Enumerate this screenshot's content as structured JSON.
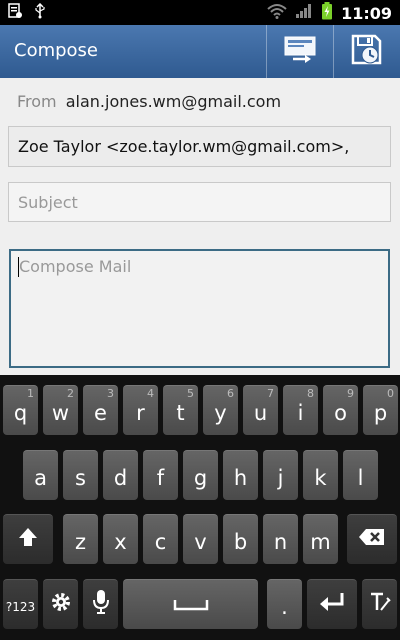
{
  "status": {
    "time": "11:09"
  },
  "actionbar": {
    "title": "Compose"
  },
  "compose": {
    "from_label": "From",
    "from_value": "alan.jones.wm@gmail.com",
    "to_value": "Zoe Taylor <zoe.taylor.wm@gmail.com>,",
    "subject_placeholder": "Subject",
    "body_placeholder": "Compose Mail"
  },
  "keyboard": {
    "row1": [
      {
        "k": "q",
        "n": "1"
      },
      {
        "k": "w",
        "n": "2"
      },
      {
        "k": "e",
        "n": "3"
      },
      {
        "k": "r",
        "n": "4"
      },
      {
        "k": "t",
        "n": "5"
      },
      {
        "k": "y",
        "n": "6"
      },
      {
        "k": "u",
        "n": "7"
      },
      {
        "k": "i",
        "n": "8"
      },
      {
        "k": "o",
        "n": "9"
      },
      {
        "k": "p",
        "n": "0"
      }
    ],
    "row2": [
      "a",
      "s",
      "d",
      "f",
      "g",
      "h",
      "j",
      "k",
      "l"
    ],
    "row3": [
      "z",
      "x",
      "c",
      "v",
      "b",
      "n",
      "m"
    ],
    "sym_label": "?123",
    "period": "."
  }
}
